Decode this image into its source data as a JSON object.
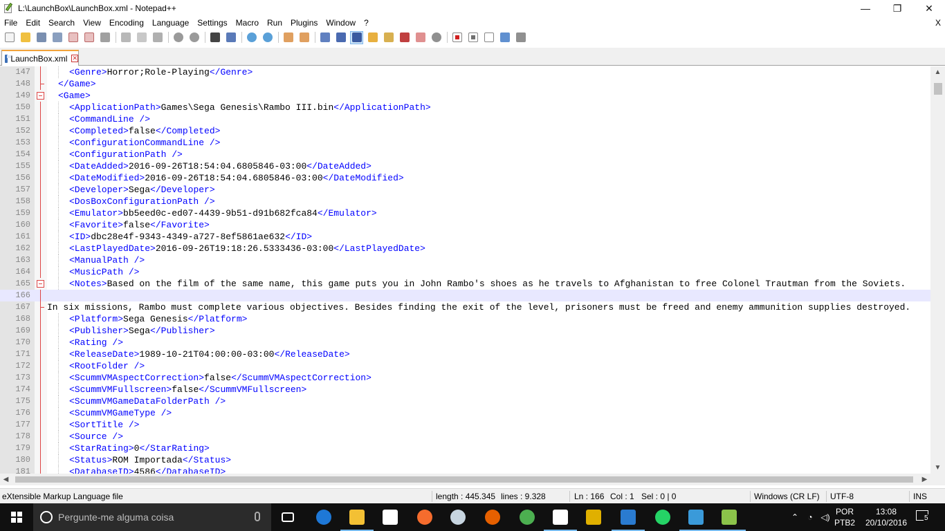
{
  "window": {
    "title": "L:\\LaunchBox\\LaunchBox.xml - Notepad++",
    "minimize": "—",
    "maximize": "❐",
    "close": "✕"
  },
  "menu": {
    "items": [
      "File",
      "Edit",
      "Search",
      "View",
      "Encoding",
      "Language",
      "Settings",
      "Macro",
      "Run",
      "Plugins",
      "Window",
      "?"
    ],
    "close_doc": "X"
  },
  "tab": {
    "label": "LaunchBox.xml",
    "close": "✕"
  },
  "editor": {
    "lines": [
      {
        "n": "147",
        "indent": 2,
        "tag_open": "<Genre>",
        "value": "Horror;Role-Playing",
        "tag_close": "</Genre>"
      },
      {
        "n": "148",
        "indent": 1,
        "tag_open": "</Game>",
        "value": "",
        "tag_close": ""
      },
      {
        "n": "149",
        "indent": 1,
        "tag_open": "<Game>",
        "value": "",
        "tag_close": ""
      },
      {
        "n": "150",
        "indent": 2,
        "tag_open": "<ApplicationPath>",
        "value": "Games\\Sega Genesis\\Rambo III.bin",
        "tag_close": "</ApplicationPath>"
      },
      {
        "n": "151",
        "indent": 2,
        "tag_open": "<CommandLine />",
        "value": "",
        "tag_close": ""
      },
      {
        "n": "152",
        "indent": 2,
        "tag_open": "<Completed>",
        "value": "false",
        "tag_close": "</Completed>"
      },
      {
        "n": "153",
        "indent": 2,
        "tag_open": "<ConfigurationCommandLine />",
        "value": "",
        "tag_close": ""
      },
      {
        "n": "154",
        "indent": 2,
        "tag_open": "<ConfigurationPath />",
        "value": "",
        "tag_close": ""
      },
      {
        "n": "155",
        "indent": 2,
        "tag_open": "<DateAdded>",
        "value": "2016-09-26T18:54:04.6805846-03:00",
        "tag_close": "</DateAdded>"
      },
      {
        "n": "156",
        "indent": 2,
        "tag_open": "<DateModified>",
        "value": "2016-09-26T18:54:04.6805846-03:00",
        "tag_close": "</DateModified>"
      },
      {
        "n": "157",
        "indent": 2,
        "tag_open": "<Developer>",
        "value": "Sega",
        "tag_close": "</Developer>"
      },
      {
        "n": "158",
        "indent": 2,
        "tag_open": "<DosBoxConfigurationPath />",
        "value": "",
        "tag_close": ""
      },
      {
        "n": "159",
        "indent": 2,
        "tag_open": "<Emulator>",
        "value": "bb5eed0c-ed07-4439-9b51-d91b682fca84",
        "tag_close": "</Emulator>"
      },
      {
        "n": "160",
        "indent": 2,
        "tag_open": "<Favorite>",
        "value": "false",
        "tag_close": "</Favorite>"
      },
      {
        "n": "161",
        "indent": 2,
        "tag_open": "<ID>",
        "value": "dbc28e4f-9343-4349-a727-8ef5861ae632",
        "tag_close": "</ID>"
      },
      {
        "n": "162",
        "indent": 2,
        "tag_open": "<LastPlayedDate>",
        "value": "2016-09-26T19:18:26.5333436-03:00",
        "tag_close": "</LastPlayedDate>"
      },
      {
        "n": "163",
        "indent": 2,
        "tag_open": "<ManualPath />",
        "value": "",
        "tag_close": ""
      },
      {
        "n": "164",
        "indent": 2,
        "tag_open": "<MusicPath />",
        "value": "",
        "tag_close": ""
      },
      {
        "n": "165",
        "indent": 2,
        "tag_open": "<Notes>",
        "value": "Based on the film of the same name, this game puts you in John Rambo's shoes as he travels to Afghanistan to free Colonel Trautman from the Soviets.",
        "tag_close": ""
      },
      {
        "n": "166",
        "indent": 0,
        "tag_open": "",
        "value": "",
        "tag_close": ""
      },
      {
        "n": "167",
        "indent": 0,
        "tag_open": "",
        "value": "In six missions, Rambo must complete various objectives. Besides finding the exit of the level, prisoners must be freed and enemy ammunition supplies destroyed.",
        "tag_close": ""
      },
      {
        "n": "168",
        "indent": 2,
        "tag_open": "<Platform>",
        "value": "Sega Genesis",
        "tag_close": "</Platform>"
      },
      {
        "n": "169",
        "indent": 2,
        "tag_open": "<Publisher>",
        "value": "Sega",
        "tag_close": "</Publisher>"
      },
      {
        "n": "170",
        "indent": 2,
        "tag_open": "<Rating />",
        "value": "",
        "tag_close": ""
      },
      {
        "n": "171",
        "indent": 2,
        "tag_open": "<ReleaseDate>",
        "value": "1989-10-21T04:00:00-03:00",
        "tag_close": "</ReleaseDate>"
      },
      {
        "n": "172",
        "indent": 2,
        "tag_open": "<RootFolder />",
        "value": "",
        "tag_close": ""
      },
      {
        "n": "173",
        "indent": 2,
        "tag_open": "<ScummVMAspectCorrection>",
        "value": "false",
        "tag_close": "</ScummVMAspectCorrection>"
      },
      {
        "n": "174",
        "indent": 2,
        "tag_open": "<ScummVMFullscreen>",
        "value": "false",
        "tag_close": "</ScummVMFullscreen>"
      },
      {
        "n": "175",
        "indent": 2,
        "tag_open": "<ScummVMGameDataFolderPath />",
        "value": "",
        "tag_close": ""
      },
      {
        "n": "176",
        "indent": 2,
        "tag_open": "<ScummVMGameType />",
        "value": "",
        "tag_close": ""
      },
      {
        "n": "177",
        "indent": 2,
        "tag_open": "<SortTitle />",
        "value": "",
        "tag_close": ""
      },
      {
        "n": "178",
        "indent": 2,
        "tag_open": "<Source />",
        "value": "",
        "tag_close": ""
      },
      {
        "n": "179",
        "indent": 2,
        "tag_open": "<StarRating>",
        "value": "0",
        "tag_close": "</StarRating>"
      },
      {
        "n": "180",
        "indent": 2,
        "tag_open": "<Status>",
        "value": "ROM Importada",
        "tag_close": "</Status>"
      },
      {
        "n": "181",
        "indent": 2,
        "tag_open": "<DatabaseID>",
        "value": "4586",
        "tag_close": "</DatabaseID>"
      }
    ],
    "current_line": "166"
  },
  "statusbar": {
    "file_type": "eXtensible Markup Language file",
    "length": "length : 445.345",
    "lines": "lines : 9.328",
    "ln": "Ln : 166",
    "col": "Col : 1",
    "sel": "Sel : 0 | 0",
    "eol": "Windows (CR LF)",
    "encoding": "UTF-8",
    "mode": "INS"
  },
  "taskbar": {
    "search_placeholder": "Pergunte-me alguma coisa",
    "lang_top": "POR",
    "lang_bottom": "PTB2",
    "time": "13:08",
    "date": "20/10/2016",
    "notif_count": "5",
    "apps": [
      {
        "name": "task-view",
        "color": "#ffffff"
      },
      {
        "name": "edge",
        "color": "#1e78d7"
      },
      {
        "name": "file-explorer",
        "color": "#f3c034"
      },
      {
        "name": "store",
        "color": "#ffffff"
      },
      {
        "name": "origin",
        "color": "#f56c2d"
      },
      {
        "name": "steam",
        "color": "#c7d5e0"
      },
      {
        "name": "firefox",
        "color": "#e66000"
      },
      {
        "name": "chrome",
        "color": "#4caf50"
      },
      {
        "name": "calculator",
        "color": "#ffffff"
      },
      {
        "name": "paint-app",
        "color": "#e0b000"
      },
      {
        "name": "remote-desktop",
        "color": "#2a7bd0"
      },
      {
        "name": "whatsapp",
        "color": "#25d366"
      },
      {
        "name": "launchbox",
        "color": "#3a9ad9"
      },
      {
        "name": "notepad-plus-plus",
        "color": "#8bc34a"
      }
    ]
  }
}
